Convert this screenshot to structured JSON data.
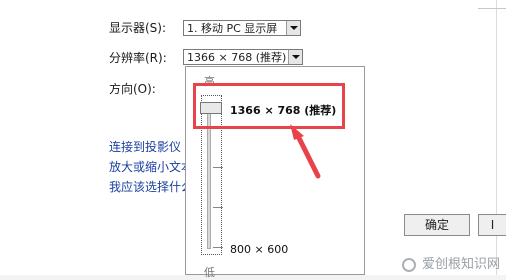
{
  "form": {
    "display_label": "显示器(S):",
    "display_value": "1. 移动 PC 显示屏",
    "resolution_label": "分辨率(R):",
    "resolution_value": "1366 × 768 (推荐)",
    "orientation_label": "方向(O):"
  },
  "links": {
    "projector": "连接到投影仪",
    "text_size": "放大或缩小文本",
    "which_choose": "我应该选择什么"
  },
  "dropdown": {
    "high_label": "高",
    "low_label": "低",
    "top_option": "1366 × 768 (推荐)",
    "bottom_option": "800 × 600",
    "slider_level_percent": 100
  },
  "buttons": {
    "ok": "确定",
    "cancel_partial": "I"
  },
  "watermark": {
    "text": "爱创根知识网"
  },
  "colors": {
    "highlight": "#e8424a",
    "link": "#1a3fa0"
  }
}
